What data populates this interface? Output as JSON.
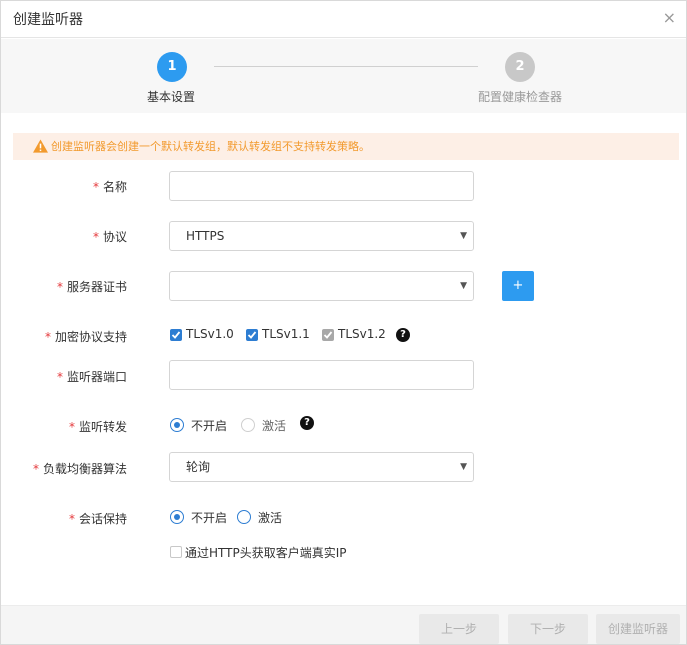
{
  "dialog": {
    "title": "创建监听器",
    "close_symbol": "×"
  },
  "steps": [
    {
      "number": "1",
      "label": "基本设置",
      "state": "active"
    },
    {
      "number": "2",
      "label": "配置健康检查器",
      "state": "inactive"
    }
  ],
  "warning": {
    "text": "创建监听器会创建一个默认转发组，默认转发组不支持转发策略。",
    "color": "#f29a2e",
    "icon": "warning-triangle-icon"
  },
  "form": {
    "required_mark": "*",
    "name": {
      "label": "名称",
      "value": ""
    },
    "protocol": {
      "label": "协议",
      "value": "HTTPS"
    },
    "certificate": {
      "label": "服务器证书",
      "value": "",
      "add_label": "+"
    },
    "tls": {
      "label": "加密协议支持",
      "options": [
        {
          "label": "TLSv1.0",
          "checked": true,
          "disabled": false
        },
        {
          "label": "TLSv1.1",
          "checked": true,
          "disabled": false
        },
        {
          "label": "TLSv1.2",
          "checked": true,
          "disabled": true
        }
      ],
      "help": "?"
    },
    "port": {
      "label": "监听器端口",
      "value": ""
    },
    "forwarding": {
      "label": "监听转发",
      "options": [
        {
          "label": "不开启",
          "selected": true
        },
        {
          "label": "激活",
          "selected": false
        }
      ],
      "help": "?"
    },
    "algorithm": {
      "label": "负载均衡器算法",
      "value": "轮询"
    },
    "session": {
      "label": "会话保持",
      "options": [
        {
          "label": "不开启",
          "selected": true
        },
        {
          "label": "激活",
          "selected": false
        }
      ]
    },
    "real_ip": {
      "label": "通过HTTP头获取客户端真实IP",
      "checked": false
    }
  },
  "footer": {
    "prev": "上一步",
    "next": "下一步",
    "create": "创建监听器"
  },
  "colors": {
    "primary": "#2d9bf0",
    "checkbox": "#2d7dd2",
    "required": "#e4393c"
  }
}
